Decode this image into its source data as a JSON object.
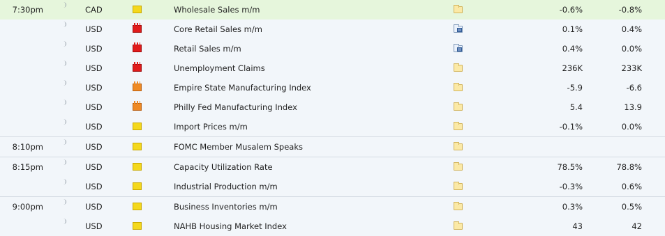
{
  "colors": {
    "highlight_row": "#e6f6dc",
    "background": "#f2f6fa",
    "impact_low": "#f4d81c",
    "impact_medium": "#ef8a23",
    "impact_high": "#e11b1b"
  },
  "rows": [
    {
      "time": "7:30pm",
      "currency": "CAD",
      "impact": "low",
      "event": "Wholesale Sales m/m",
      "detail_icon": "folder-icon",
      "actual": "-0.6%",
      "previous": "-0.8%",
      "highlight": true,
      "group_start": false
    },
    {
      "time": "",
      "currency": "USD",
      "impact": "high",
      "event": "Core Retail Sales m/m",
      "detail_icon": "document-chart-icon",
      "actual": "0.1%",
      "previous": "0.4%",
      "highlight": false,
      "group_start": false
    },
    {
      "time": "",
      "currency": "USD",
      "impact": "high",
      "event": "Retail Sales m/m",
      "detail_icon": "document-chart-icon",
      "actual": "0.4%",
      "previous": "0.0%",
      "highlight": false,
      "group_start": false
    },
    {
      "time": "",
      "currency": "USD",
      "impact": "high",
      "event": "Unemployment Claims",
      "detail_icon": "folder-icon",
      "actual": "236K",
      "previous": "233K",
      "highlight": false,
      "group_start": false
    },
    {
      "time": "",
      "currency": "USD",
      "impact": "medium",
      "event": "Empire State Manufacturing Index",
      "detail_icon": "folder-icon",
      "actual": "-5.9",
      "previous": "-6.6",
      "highlight": false,
      "group_start": false
    },
    {
      "time": "",
      "currency": "USD",
      "impact": "medium",
      "event": "Philly Fed Manufacturing Index",
      "detail_icon": "folder-icon",
      "actual": "5.4",
      "previous": "13.9",
      "highlight": false,
      "group_start": false
    },
    {
      "time": "",
      "currency": "USD",
      "impact": "low",
      "event": "Import Prices m/m",
      "detail_icon": "folder-icon",
      "actual": "-0.1%",
      "previous": "0.0%",
      "highlight": false,
      "group_start": false
    },
    {
      "time": "8:10pm",
      "currency": "USD",
      "impact": "low",
      "event": "FOMC Member Musalem Speaks",
      "detail_icon": "folder-icon",
      "actual": "",
      "previous": "",
      "highlight": false,
      "group_start": true
    },
    {
      "time": "8:15pm",
      "currency": "USD",
      "impact": "low",
      "event": "Capacity Utilization Rate",
      "detail_icon": "folder-icon",
      "actual": "78.5%",
      "previous": "78.8%",
      "highlight": false,
      "group_start": true
    },
    {
      "time": "",
      "currency": "USD",
      "impact": "low",
      "event": "Industrial Production m/m",
      "detail_icon": "folder-icon",
      "actual": "-0.3%",
      "previous": "0.6%",
      "highlight": false,
      "group_start": false
    },
    {
      "time": "9:00pm",
      "currency": "USD",
      "impact": "low",
      "event": "Business Inventories m/m",
      "detail_icon": "folder-icon",
      "actual": "0.3%",
      "previous": "0.5%",
      "highlight": false,
      "group_start": true
    },
    {
      "time": "",
      "currency": "USD",
      "impact": "low",
      "event": "NAHB Housing Market Index",
      "detail_icon": "folder-icon",
      "actual": "43",
      "previous": "42",
      "highlight": false,
      "group_start": false
    }
  ]
}
